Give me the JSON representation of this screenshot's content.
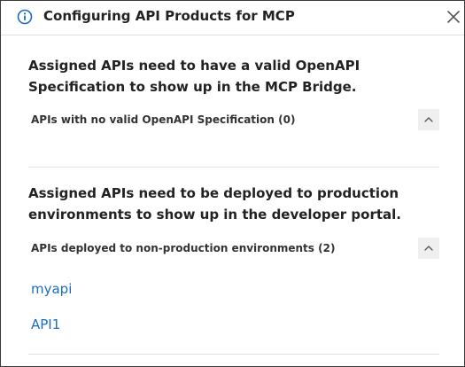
{
  "header": {
    "title": "Configuring API Products for MCP",
    "info_icon": "info-circle-icon",
    "close_icon": "close-icon"
  },
  "section1": {
    "message": "Assigned APIs need to have a valid OpenAPI Specification to show up in the MCP Bridge.",
    "accordion_label": "APIs with no valid OpenAPI Specification (0)",
    "accordion_icon": "chevron-up-icon"
  },
  "section2": {
    "message": "Assigned APIs need to be deployed to production environments to show up in the developer portal.",
    "accordion_label": "APIs deployed to non-production environments (2)",
    "accordion_icon": "chevron-up-icon",
    "apis": [
      "myapi",
      "API1"
    ]
  },
  "colors": {
    "link": "#1a6dc2",
    "border": "#3a3a3a",
    "divider": "#e1e1e1",
    "toggle_bg": "#efefef"
  }
}
